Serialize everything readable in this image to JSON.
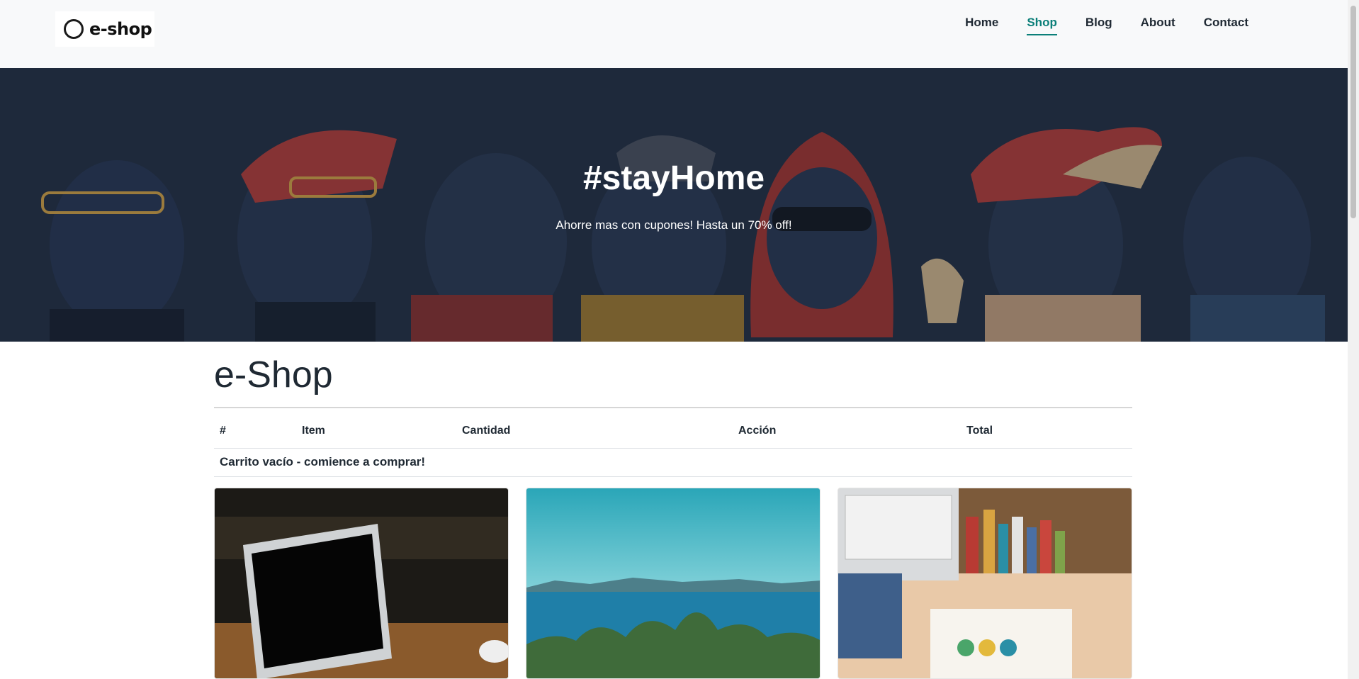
{
  "brand": {
    "logo_text": "e-shop"
  },
  "nav": {
    "items": [
      {
        "label": "Home"
      },
      {
        "label": "Shop",
        "active": true
      },
      {
        "label": "Blog"
      },
      {
        "label": "About"
      },
      {
        "label": "Contact"
      }
    ],
    "active_color": "#0b7f79"
  },
  "hero": {
    "title": "#stayHome",
    "subtitle": "Ahorre mas con cupones! Hasta un 70% off!"
  },
  "shop": {
    "title": "e-Shop",
    "cart": {
      "columns": [
        "#",
        "Item",
        "Cantidad",
        "Acción",
        "Total"
      ],
      "empty_message": "Carrito vacío - comience a comprar!"
    }
  },
  "products": [
    {
      "image": "laptop-on-table"
    },
    {
      "image": "sea-and-trees"
    },
    {
      "image": "desk-books-laptop"
    }
  ]
}
